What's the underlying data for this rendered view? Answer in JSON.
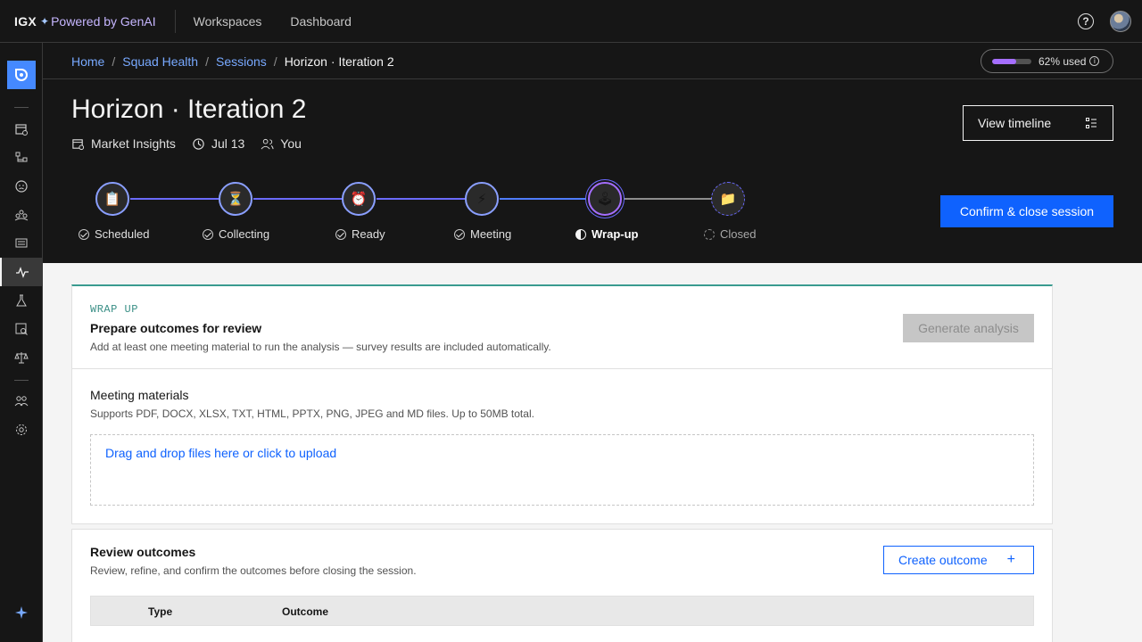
{
  "header": {
    "brand_name": "IGX",
    "brand_sep": "✦",
    "brand_tag": "Powered by GenAI",
    "nav": [
      "Workspaces",
      "Dashboard"
    ],
    "help": "?"
  },
  "breadcrumb": {
    "items": [
      "Home",
      "Squad Health",
      "Sessions"
    ],
    "current": "Horizon · Iteration 2"
  },
  "usage": {
    "label": "62% used",
    "fraction": 0.62
  },
  "session": {
    "title": "Horizon · Iteration 2",
    "workspace": "Market Insights",
    "date": "Jul 13",
    "owner": "You"
  },
  "actions": {
    "view_timeline": "View timeline",
    "confirm_close": "Confirm & close session"
  },
  "steps": [
    {
      "label": "Scheduled",
      "icon": "📋",
      "status": "done"
    },
    {
      "label": "Collecting",
      "icon": "⏳",
      "status": "done"
    },
    {
      "label": "Ready",
      "icon": "⏰",
      "status": "done"
    },
    {
      "label": "Meeting",
      "icon": "⚡",
      "status": "done"
    },
    {
      "label": "Wrap-up",
      "icon": "🕹",
      "status": "current"
    },
    {
      "label": "Closed",
      "icon": "📁",
      "status": "pending"
    }
  ],
  "wrapup": {
    "eyebrow": "WRAP UP",
    "title": "Prepare outcomes for review",
    "subtitle": "Add at least one meeting material to run the analysis — survey results are included automatically.",
    "generate": "Generate analysis",
    "materials_title": "Meeting materials",
    "materials_sub": "Supports PDF, DOCX, XLSX, TXT, HTML, PPTX, PNG, JPEG and MD files. Up to 50MB total.",
    "dropzone": "Drag and drop files here or click to upload"
  },
  "review": {
    "title": "Review outcomes",
    "subtitle": "Review, refine, and confirm the outcomes before closing the session.",
    "create": "Create outcome",
    "plus": "+",
    "columns": [
      "Type",
      "Outcome"
    ]
  },
  "colors": {
    "primary": "#0f62fe",
    "accent": "#a56eff",
    "teal": "#3a9b8f"
  }
}
